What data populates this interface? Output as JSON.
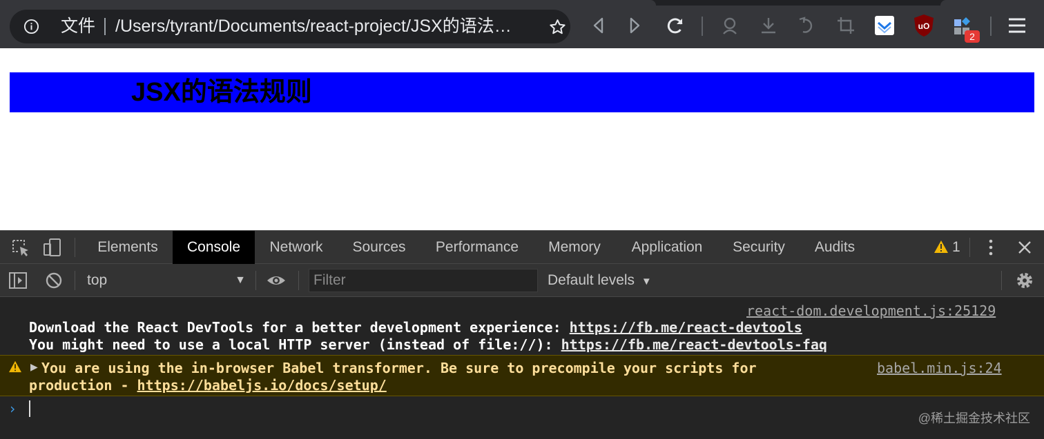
{
  "browser": {
    "scheme_label": "文件",
    "url": "/Users/tyrant/Documents/react-project/JSX的语法…",
    "extension_badge": "2",
    "icons": [
      "info-icon",
      "bookmark-star-icon",
      "back-icon",
      "forward-icon",
      "reload-icon",
      "profile-icon",
      "download-icon",
      "undo-icon",
      "crop-icon",
      "pocket-extension-icon",
      "ublock-extension-icon",
      "extensions-icon",
      "menu-icon"
    ]
  },
  "page": {
    "heading": "JSX的语法规则",
    "heading_bg": "#0000ff"
  },
  "devtools": {
    "tabs": [
      "Elements",
      "Console",
      "Network",
      "Sources",
      "Performance",
      "Memory",
      "Application",
      "Security",
      "Audits"
    ],
    "active_tab": "Console",
    "warning_count": "1",
    "context": "top",
    "filter_placeholder": "Filter",
    "levels_label": "Default levels",
    "messages": {
      "info_source": "react-dom.development.js:25129",
      "info_line1_text": "Download the React DevTools for a better development experience: ",
      "info_line1_link": "https://fb.me/react-devtools",
      "info_line2_text": "You might need to use a local HTTP server (instead of file://): ",
      "info_line2_link": "https://fb.me/react-devtools-faq",
      "warn_source": "babel.min.js:24",
      "warn_line1": "You are using the in-browser Babel transformer. Be sure to precompile your scripts for",
      "warn_line2_text": "production - ",
      "warn_line2_link": "https://babeljs.io/docs/setup/"
    },
    "watermark": "@稀土掘金技术社区"
  }
}
